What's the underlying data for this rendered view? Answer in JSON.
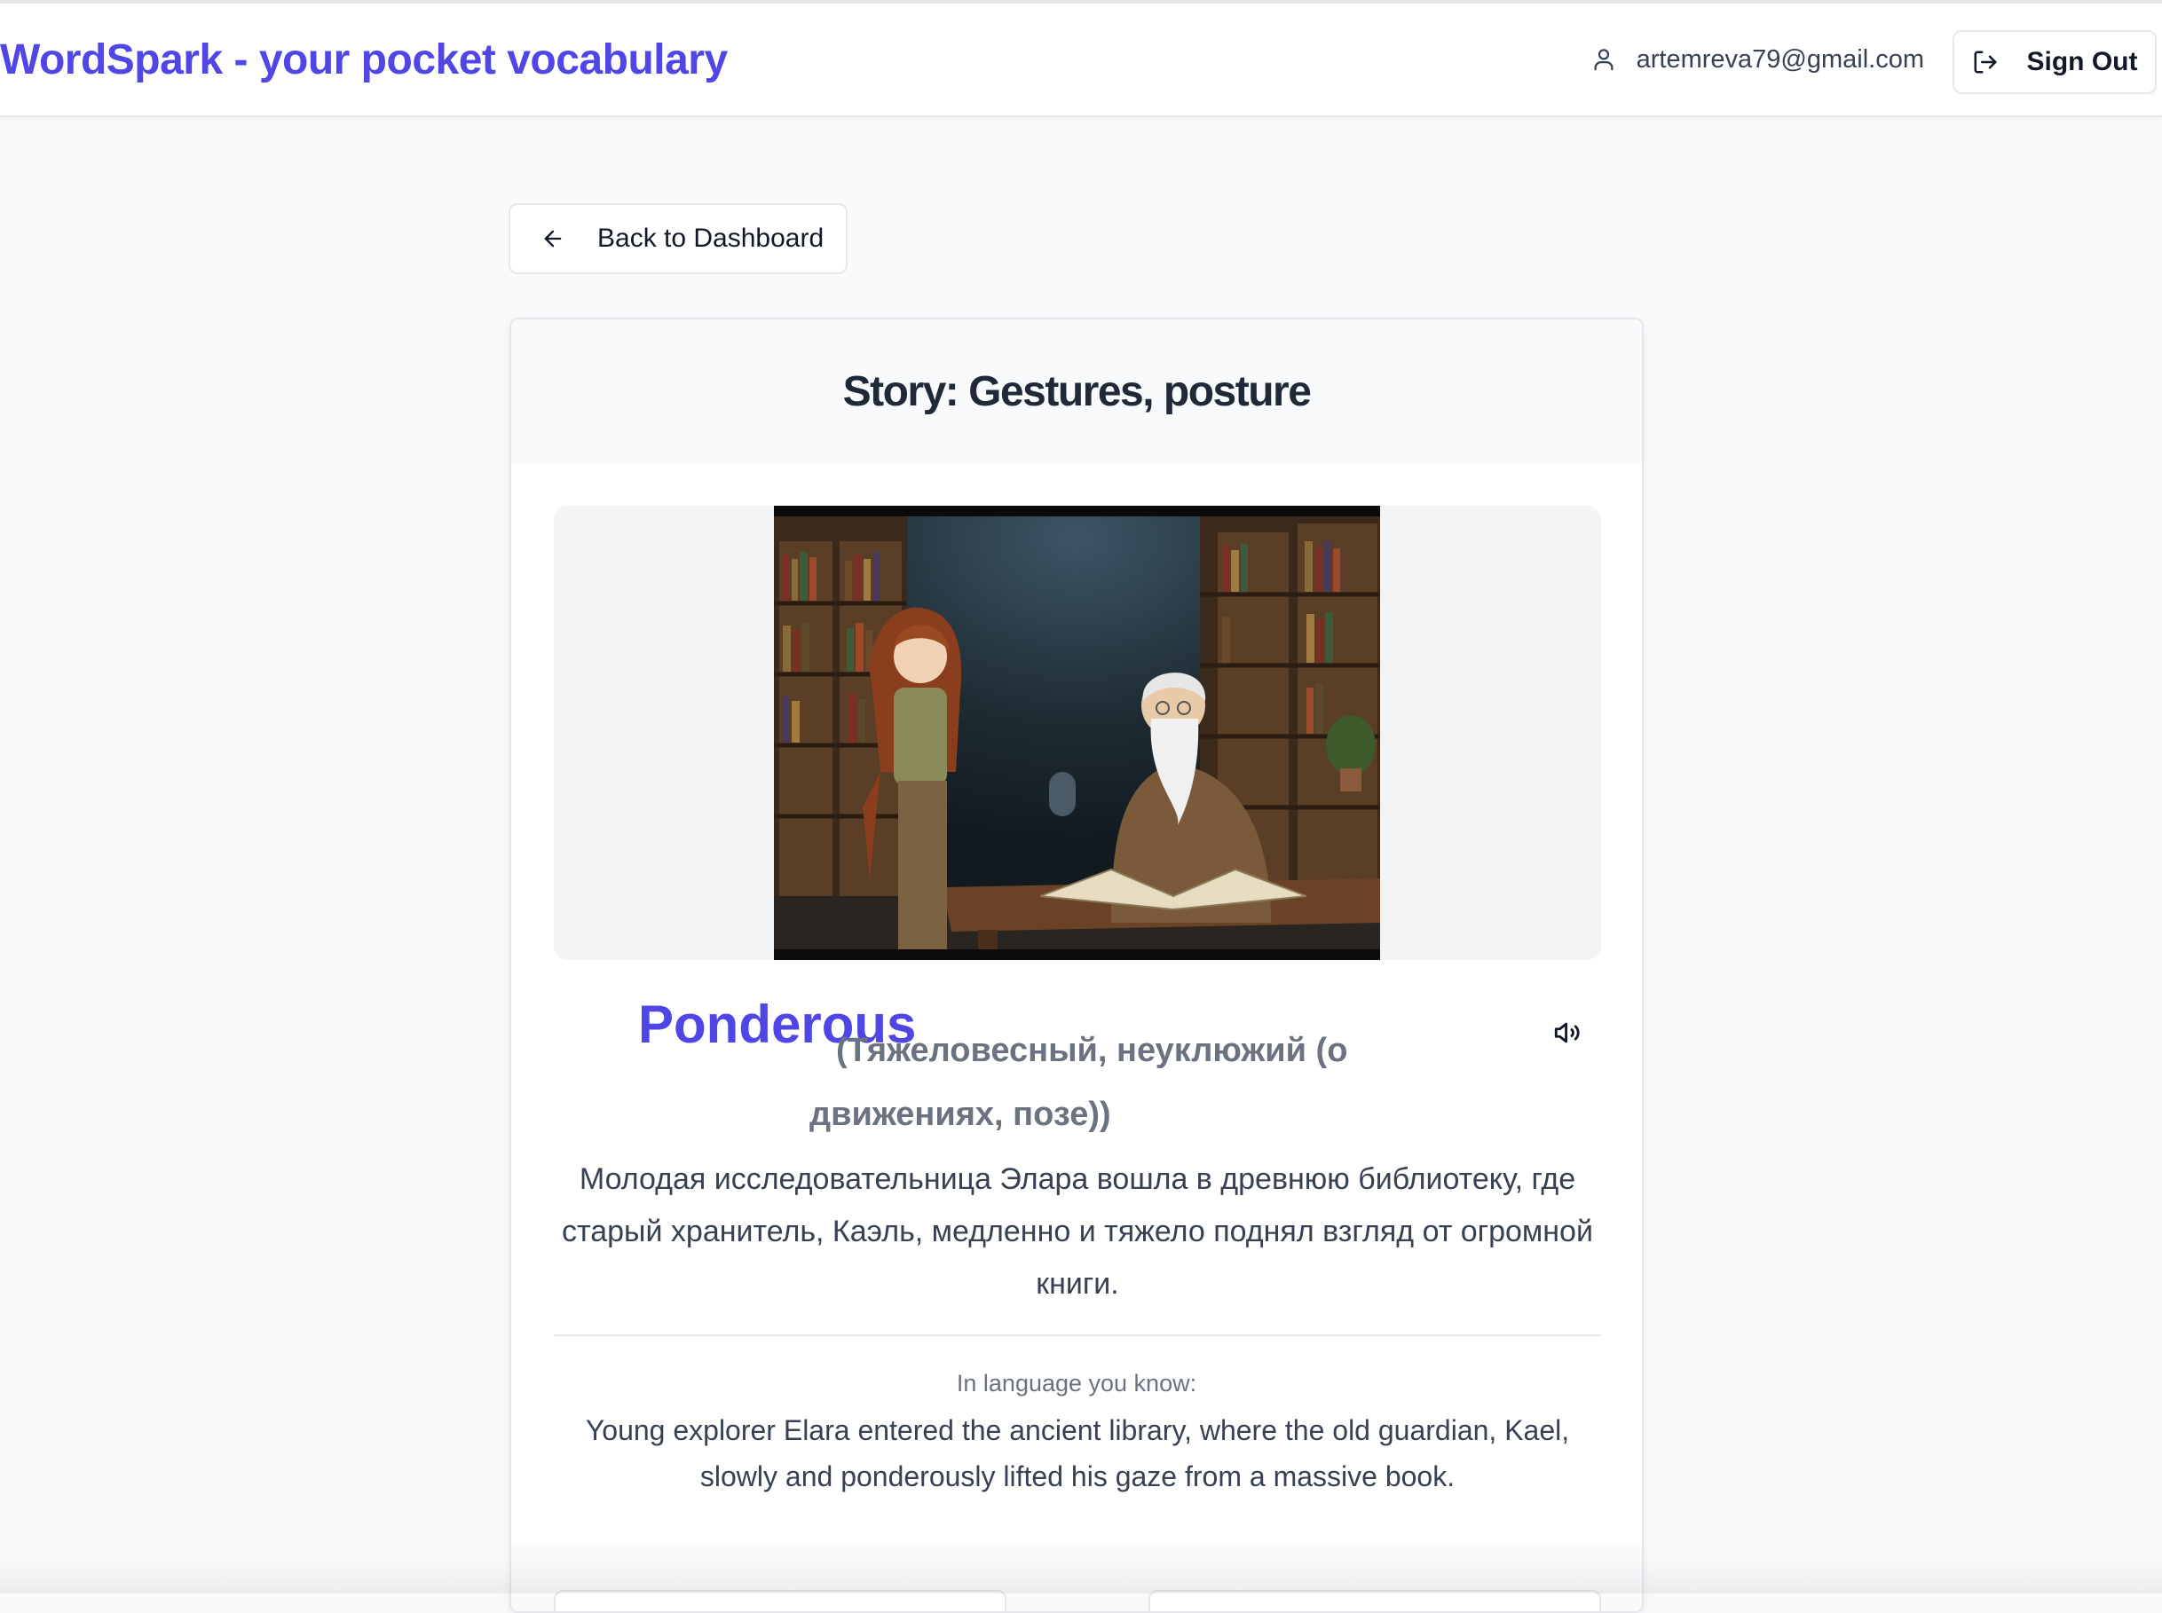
{
  "header": {
    "app_title": "WordSpark - your pocket vocabulary",
    "user_email": "artemreva79@gmail.com",
    "sign_out_label": "Sign Out"
  },
  "nav": {
    "back_label": "Back to Dashboard"
  },
  "story": {
    "title": "Story: Gestures, posture",
    "image_alt": "Illustration: a young explorer standing beside an old bearded librarian reading a large book in an ancient library",
    "word": "Ponderous",
    "translation_line1": "(Тяжеловесный, неуклюжий (о",
    "translation_line2": "движениях, позе))",
    "sentence": "Молодая исследовательница Элара вошла в древнюю библиотеку, где старый хранитель, Каэль, медленно и тяжело поднял взгляд от огромной книги.",
    "known_label": "In language you know:",
    "known_text": "Young explorer Elara entered the ancient library, where the old guardian, Kael, slowly and ponderously lifted his gaze from a massive book."
  },
  "icons": {
    "user": "user-icon",
    "sign_out": "log-out-icon",
    "back": "arrow-left-icon",
    "speaker": "volume-icon"
  },
  "colors": {
    "accent": "#4f46e5",
    "text": "#1f2937",
    "muted": "#6b7280",
    "background": "#f9fafb"
  }
}
